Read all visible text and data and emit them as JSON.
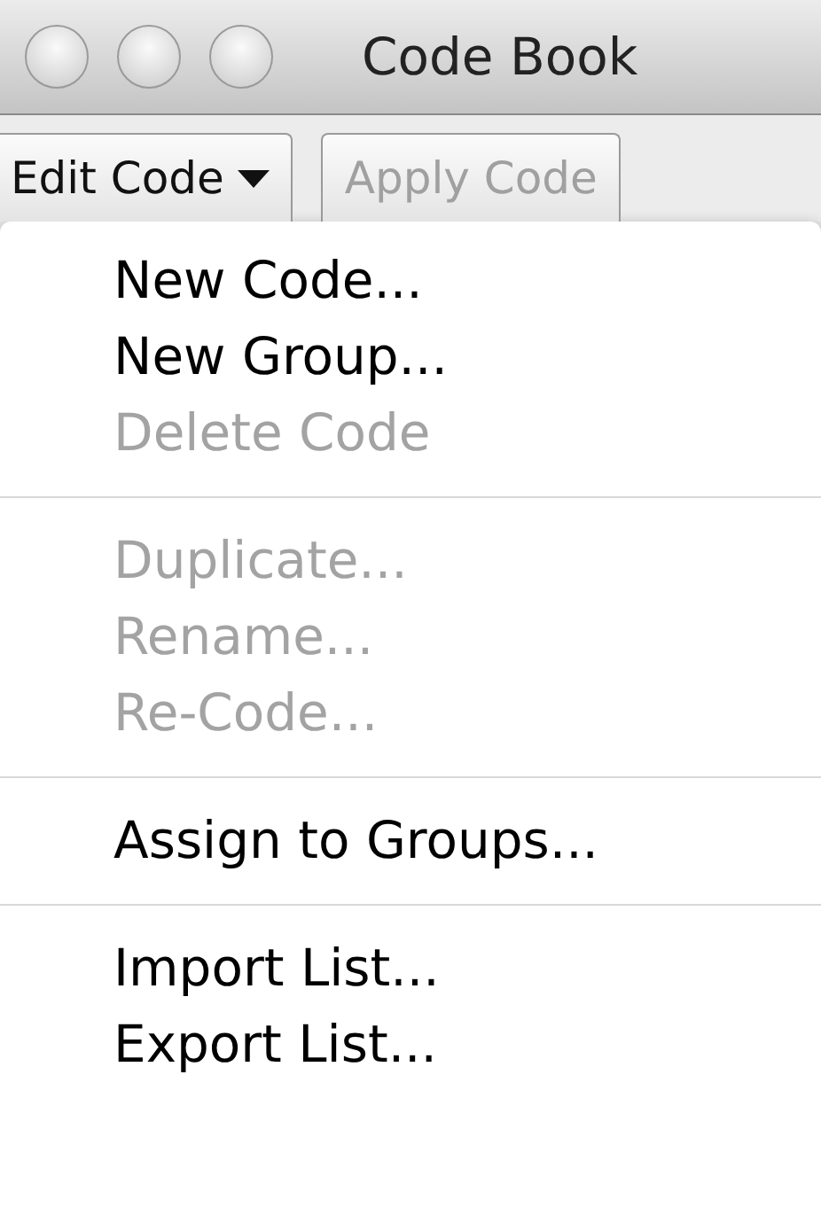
{
  "window": {
    "title": "Code Book"
  },
  "toolbar": [
    {
      "kind": "menu",
      "label": "Edit Code"
    },
    {
      "kind": "plain",
      "label": "Apply Code",
      "disabled": true
    }
  ],
  "menu": [
    {
      "kind": "item",
      "label": "New Code...",
      "disabled": false
    },
    {
      "kind": "item",
      "label": "New Group...",
      "disabled": false
    },
    {
      "kind": "item",
      "label": "Delete Code",
      "disabled": true
    },
    {
      "kind": "separator"
    },
    {
      "kind": "item",
      "label": "Duplicate...",
      "disabled": true
    },
    {
      "kind": "item",
      "label": "Rename...",
      "disabled": true
    },
    {
      "kind": "item",
      "label": "Re-Code...",
      "disabled": true
    },
    {
      "kind": "separator"
    },
    {
      "kind": "item",
      "label": "Assign to Groups...",
      "disabled": false
    },
    {
      "kind": "separator"
    },
    {
      "kind": "item",
      "label": "Import List...",
      "disabled": false
    },
    {
      "kind": "item",
      "label": "Export List...",
      "disabled": false
    }
  ]
}
